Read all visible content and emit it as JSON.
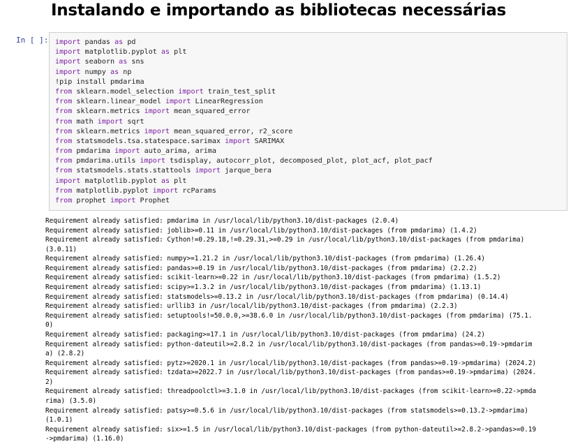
{
  "heading": "Instalando e importando as bibliotecas necessárias",
  "cell": {
    "prompt": "In [ ]:",
    "lines": [
      {
        "k1": "import",
        "t1": " pandas ",
        "k2": "as",
        "t2": " pd",
        "k3": "",
        "t3": ""
      },
      {
        "k1": "import",
        "t1": " matplotlib.pyplot ",
        "k2": "as",
        "t2": " plt",
        "k3": "",
        "t3": ""
      },
      {
        "k1": "import",
        "t1": " seaborn ",
        "k2": "as",
        "t2": " sns",
        "k3": "",
        "t3": ""
      },
      {
        "k1": "import",
        "t1": " numpy ",
        "k2": "as",
        "t2": " np",
        "k3": "",
        "t3": ""
      },
      {
        "k1": "",
        "t1": "!pip install pmdarima",
        "k2": "",
        "t2": "",
        "k3": "",
        "t3": ""
      },
      {
        "k1": "from",
        "t1": " sklearn.model_selection ",
        "k2": "import",
        "t2": " train_test_split",
        "k3": "",
        "t3": ""
      },
      {
        "k1": "from",
        "t1": " sklearn.linear_model ",
        "k2": "import",
        "t2": " LinearRegression",
        "k3": "",
        "t3": ""
      },
      {
        "k1": "from",
        "t1": " sklearn.metrics ",
        "k2": "import",
        "t2": " mean_squared_error",
        "k3": "",
        "t3": ""
      },
      {
        "k1": "from",
        "t1": " math ",
        "k2": "import",
        "t2": " sqrt",
        "k3": "",
        "t3": ""
      },
      {
        "k1": "from",
        "t1": " sklearn.metrics ",
        "k2": "import",
        "t2": " mean_squared_error, r2_score",
        "k3": "",
        "t3": ""
      },
      {
        "k1": "from",
        "t1": " statsmodels.tsa.statespace.sarimax ",
        "k2": "import",
        "t2": " SARIMAX",
        "k3": "",
        "t3": ""
      },
      {
        "k1": "from",
        "t1": " pmdarima ",
        "k2": "import",
        "t2": " auto_arima, arima",
        "k3": "",
        "t3": ""
      },
      {
        "k1": "from",
        "t1": " pmdarima.utils ",
        "k2": "import",
        "t2": " tsdisplay, autocorr_plot, decomposed_plot, plot_acf, plot_pacf",
        "k3": "",
        "t3": ""
      },
      {
        "k1": "from",
        "t1": " statsmodels.stats.stattools ",
        "k2": "import",
        "t2": " jarque_bera",
        "k3": "",
        "t3": ""
      },
      {
        "k1": "import",
        "t1": " matplotlib.pyplot ",
        "k2": "as",
        "t2": " plt",
        "k3": "",
        "t3": ""
      },
      {
        "k1": "from",
        "t1": " matplotlib.pyplot ",
        "k2": "import",
        "t2": " rcParams",
        "k3": "",
        "t3": ""
      },
      {
        "k1": "from",
        "t1": " prophet ",
        "k2": "import",
        "t2": " Prophet",
        "k3": "",
        "t3": ""
      }
    ]
  },
  "output_lines": [
    "Requirement already satisfied: pmdarima in /usr/local/lib/python3.10/dist-packages (2.0.4)",
    "Requirement already satisfied: joblib>=0.11 in /usr/local/lib/python3.10/dist-packages (from pmdarima) (1.4.2)",
    "Requirement already satisfied: Cython!=0.29.18,!=0.29.31,>=0.29 in /usr/local/lib/python3.10/dist-packages (from pmdarima)",
    "(3.0.11)",
    "Requirement already satisfied: numpy>=1.21.2 in /usr/local/lib/python3.10/dist-packages (from pmdarima) (1.26.4)",
    "Requirement already satisfied: pandas>=0.19 in /usr/local/lib/python3.10/dist-packages (from pmdarima) (2.2.2)",
    "Requirement already satisfied: scikit-learn>=0.22 in /usr/local/lib/python3.10/dist-packages (from pmdarima) (1.5.2)",
    "Requirement already satisfied: scipy>=1.3.2 in /usr/local/lib/python3.10/dist-packages (from pmdarima) (1.13.1)",
    "Requirement already satisfied: statsmodels>=0.13.2 in /usr/local/lib/python3.10/dist-packages (from pmdarima) (0.14.4)",
    "Requirement already satisfied: urllib3 in /usr/local/lib/python3.10/dist-packages (from pmdarima) (2.2.3)",
    "Requirement already satisfied: setuptools!=50.0.0,>=38.6.0 in /usr/local/lib/python3.10/dist-packages (from pmdarima) (75.1.",
    "0)",
    "Requirement already satisfied: packaging>=17.1 in /usr/local/lib/python3.10/dist-packages (from pmdarima) (24.2)",
    "Requirement already satisfied: python-dateutil>=2.8.2 in /usr/local/lib/python3.10/dist-packages (from pandas>=0.19->pmdarim",
    "a) (2.8.2)",
    "Requirement already satisfied: pytz>=2020.1 in /usr/local/lib/python3.10/dist-packages (from pandas>=0.19->pmdarima) (2024.2)",
    "Requirement already satisfied: tzdata>=2022.7 in /usr/local/lib/python3.10/dist-packages (from pandas>=0.19->pmdarima) (2024.",
    "2)",
    "Requirement already satisfied: threadpoolctl>=3.1.0 in /usr/local/lib/python3.10/dist-packages (from scikit-learn>=0.22->pmda",
    "rima) (3.5.0)",
    "Requirement already satisfied: patsy>=0.5.6 in /usr/local/lib/python3.10/dist-packages (from statsmodels>=0.13.2->pmdarima)",
    "(1.0.1)",
    "Requirement already satisfied: six>=1.5 in /usr/local/lib/python3.10/dist-packages (from python-dateutil>=2.8.2->pandas>=0.19",
    "->pmdarima) (1.16.0)"
  ]
}
